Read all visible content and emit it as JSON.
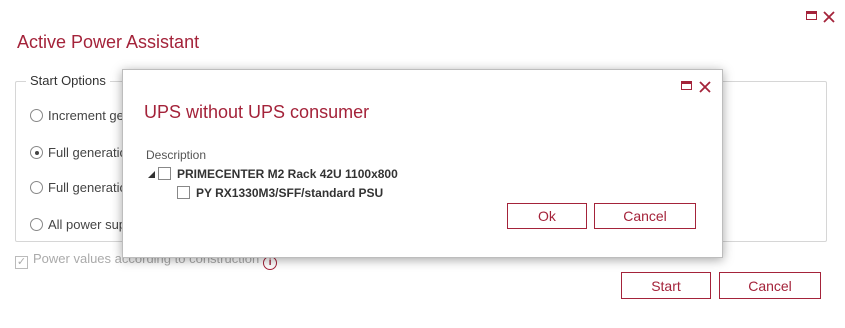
{
  "main": {
    "title": "Active Power Assistant",
    "start_options_legend": "Start Options",
    "options": [
      {
        "label": "Increment generation",
        "selected": false
      },
      {
        "label": "Full generation",
        "selected": true
      },
      {
        "label": "Full generation",
        "selected": false
      },
      {
        "label": "All power supplies",
        "selected": false
      }
    ],
    "power_values_label": "Power values according to construction",
    "power_values_checked": true,
    "info_glyph": "i",
    "start_label": "Start",
    "cancel_label": "Cancel"
  },
  "modal": {
    "title": "UPS without UPS consumer",
    "description_label": "Description",
    "tree": [
      {
        "label": "PRIMECENTER M2 Rack 42U 1100x800",
        "level": 0,
        "expanded": true,
        "checked": false
      },
      {
        "label": "PY RX1330M3/SFF/standard PSU",
        "level": 1,
        "expanded": false,
        "checked": false
      }
    ],
    "ok_label": "Ok",
    "cancel_label": "Cancel"
  },
  "colors": {
    "accent": "#a4233a",
    "border": "#d6d6d6",
    "text": "#444444"
  },
  "icons": [
    "maximize-icon",
    "close-icon",
    "info-icon",
    "tree-expand-icon"
  ]
}
